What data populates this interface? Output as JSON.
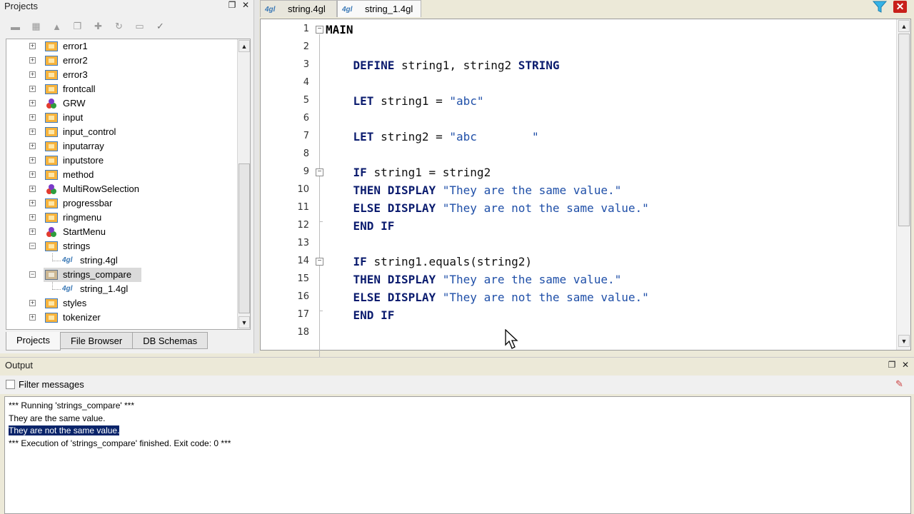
{
  "projects_panel": {
    "title": "Projects",
    "tree": [
      {
        "label": "error1",
        "icon": "folder-icon",
        "expander": "+"
      },
      {
        "label": "error2",
        "icon": "folder-icon",
        "expander": "+"
      },
      {
        "label": "error3",
        "icon": "folder-icon",
        "expander": "+"
      },
      {
        "label": "frontcall",
        "icon": "folder-icon",
        "expander": "+"
      },
      {
        "label": "GRW",
        "icon": "group-icon",
        "expander": "+"
      },
      {
        "label": "input",
        "icon": "folder-icon",
        "expander": "+"
      },
      {
        "label": "input_control",
        "icon": "folder-icon",
        "expander": "+"
      },
      {
        "label": "inputarray",
        "icon": "folder-icon",
        "expander": "+"
      },
      {
        "label": "inputstore",
        "icon": "folder-icon",
        "expander": "+"
      },
      {
        "label": "method",
        "icon": "folder-icon",
        "expander": "+"
      },
      {
        "label": "MultiRowSelection",
        "icon": "group-icon",
        "expander": "+"
      },
      {
        "label": "progressbar",
        "icon": "folder-icon",
        "expander": "+"
      },
      {
        "label": "ringmenu",
        "icon": "folder-icon",
        "expander": "+"
      },
      {
        "label": "StartMenu",
        "icon": "group-icon",
        "expander": "+"
      },
      {
        "label": "strings",
        "icon": "folder-icon",
        "expander": "-"
      },
      {
        "label": "string.4gl",
        "icon": "4gl-file-icon",
        "expander": ""
      },
      {
        "label": "strings_compare",
        "icon": "folder-icon",
        "expander": "-",
        "selected": true
      },
      {
        "label": "string_1.4gl",
        "icon": "4gl-file-icon",
        "expander": ""
      },
      {
        "label": "styles",
        "icon": "folder-icon",
        "expander": "+"
      },
      {
        "label": "tokenizer",
        "icon": "folder-icon",
        "expander": "+"
      }
    ],
    "tabs": [
      "Projects",
      "File Browser",
      "DB Schemas"
    ],
    "active_tab": "Projects"
  },
  "editor": {
    "tabs": [
      {
        "label": "string.4gl",
        "icon_text": "4gl"
      },
      {
        "label": "string_1.4gl",
        "icon_text": "4gl",
        "active": true
      }
    ],
    "close_symbol": "✕",
    "lines": [
      {
        "n": "1",
        "tokens": [
          {
            "t": "MAIN",
            "c": "kw-black"
          }
        ]
      },
      {
        "n": "2",
        "tokens": []
      },
      {
        "n": "3",
        "tokens": [
          {
            "t": "    DEFINE ",
            "c": "kw"
          },
          {
            "t": "string1, string2 ",
            "c": "plain"
          },
          {
            "t": "STRING",
            "c": "kw"
          }
        ]
      },
      {
        "n": "4",
        "tokens": []
      },
      {
        "n": "5",
        "tokens": [
          {
            "t": "    LET ",
            "c": "kw"
          },
          {
            "t": "string1 = ",
            "c": "plain"
          },
          {
            "t": "\"abc\"",
            "c": "str"
          }
        ]
      },
      {
        "n": "6",
        "tokens": []
      },
      {
        "n": "7",
        "tokens": [
          {
            "t": "    LET ",
            "c": "kw"
          },
          {
            "t": "string2 = ",
            "c": "plain"
          },
          {
            "t": "\"abc        \"",
            "c": "str"
          }
        ]
      },
      {
        "n": "8",
        "tokens": []
      },
      {
        "n": "9",
        "tokens": [
          {
            "t": "    IF ",
            "c": "kw"
          },
          {
            "t": "string1 = string2",
            "c": "plain"
          }
        ]
      },
      {
        "n": "10",
        "tokens": [
          {
            "t": "    THEN DISPLAY ",
            "c": "kw"
          },
          {
            "t": "\"They are the same value.\"",
            "c": "str"
          }
        ]
      },
      {
        "n": "11",
        "tokens": [
          {
            "t": "    ELSE DISPLAY ",
            "c": "kw"
          },
          {
            "t": "\"They are not the same value.\"",
            "c": "str"
          }
        ]
      },
      {
        "n": "12",
        "tokens": [
          {
            "t": "    END IF",
            "c": "kw"
          }
        ]
      },
      {
        "n": "13",
        "tokens": []
      },
      {
        "n": "14",
        "tokens": [
          {
            "t": "    IF ",
            "c": "kw"
          },
          {
            "t": "string1.equals(string2)",
            "c": "plain"
          }
        ]
      },
      {
        "n": "15",
        "tokens": [
          {
            "t": "    THEN DISPLAY ",
            "c": "kw"
          },
          {
            "t": "\"They are the same value.\"",
            "c": "str"
          }
        ]
      },
      {
        "n": "16",
        "tokens": [
          {
            "t": "    ELSE DISPLAY ",
            "c": "kw"
          },
          {
            "t": "\"They are not the same value.\"",
            "c": "str"
          }
        ]
      },
      {
        "n": "17",
        "tokens": [
          {
            "t": "    END IF",
            "c": "kw"
          }
        ]
      },
      {
        "n": "18",
        "tokens": []
      }
    ]
  },
  "output": {
    "title": "Output",
    "filter_label": "Filter messages",
    "lines": [
      "*** Running 'strings_compare' ***",
      "They are the same value.",
      "They are not the same value.",
      "*** Execution of 'strings_compare' finished. Exit code: 0 ***"
    ],
    "selected_line": 2
  },
  "colors": {
    "keyword": "#0a1b6e",
    "string": "#1f4fa8",
    "selection": "#0a246a",
    "close_button": "#c8201a"
  }
}
